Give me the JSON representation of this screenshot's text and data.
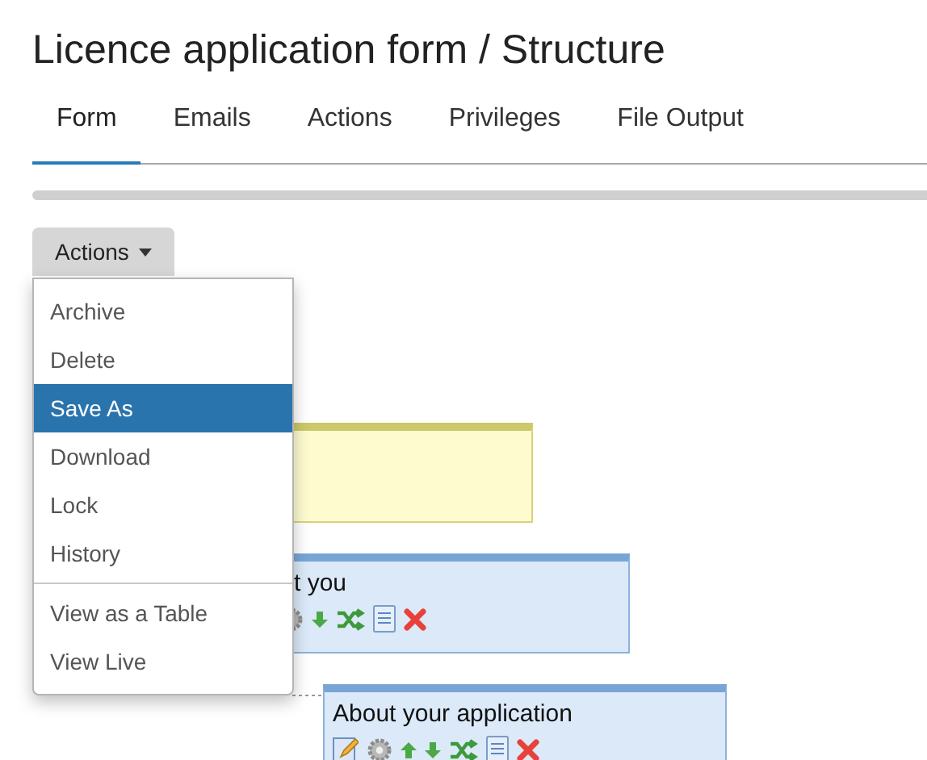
{
  "title": "Licence application form / Structure",
  "tabs": [
    {
      "label": "Form",
      "selected": true
    },
    {
      "label": "Emails",
      "selected": false
    },
    {
      "label": "Actions",
      "selected": false
    },
    {
      "label": "Privileges",
      "selected": false
    },
    {
      "label": "File Output",
      "selected": false
    }
  ],
  "actions_button": {
    "label": "Actions",
    "expanded": true
  },
  "menu": [
    {
      "kind": "item",
      "label": "Archive",
      "selected": false
    },
    {
      "kind": "item",
      "label": "Delete",
      "selected": false
    },
    {
      "kind": "item",
      "label": "Save As",
      "selected": true
    },
    {
      "kind": "item",
      "label": "Download",
      "selected": false
    },
    {
      "kind": "item",
      "label": "Lock",
      "selected": false
    },
    {
      "kind": "item",
      "label": "History",
      "selected": false
    },
    {
      "kind": "divider"
    },
    {
      "kind": "item",
      "label": "View as a Table",
      "selected": false
    },
    {
      "kind": "item",
      "label": "View Live",
      "selected": false
    }
  ],
  "nodes": [
    {
      "kind": "note"
    },
    {
      "kind": "section",
      "title": "t you",
      "icons": [
        {
          "kind": "gear"
        },
        {
          "kind": "down"
        },
        {
          "kind": "shuffle"
        },
        {
          "kind": "document"
        },
        {
          "kind": "delete"
        }
      ]
    },
    {
      "kind": "section",
      "title": "About your application",
      "icons": [
        {
          "kind": "edit"
        },
        {
          "kind": "gear"
        },
        {
          "kind": "up"
        },
        {
          "kind": "down"
        },
        {
          "kind": "shuffle"
        },
        {
          "kind": "document"
        },
        {
          "kind": "delete"
        }
      ]
    }
  ]
}
